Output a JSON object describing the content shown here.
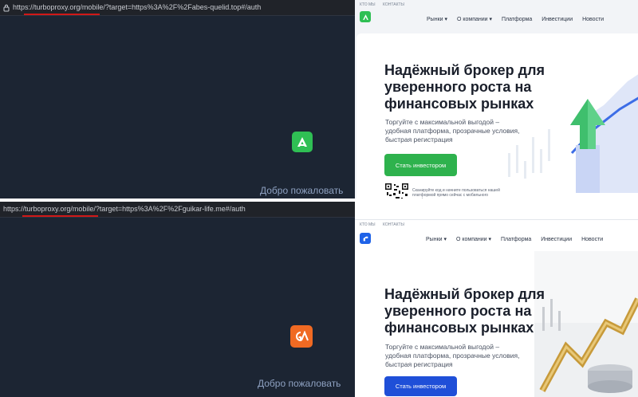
{
  "top": {
    "url": "https://turboproxy.org/mobile/?target=https%3A%2F%2Fabes-quelid.top#/auth",
    "welcome": "Добро пожаловать",
    "logo_icon": "green-a-logo-icon",
    "logo_color": "#2fbf54",
    "site": {
      "topline": [
        "КТО МЫ",
        "КОНТАКТЫ"
      ],
      "nav": [
        "Рынки ▾",
        "О компании ▾",
        "Платформа",
        "Инвестиции",
        "Новости"
      ],
      "hero_title": "Надёжный брокер для уверенного роста на финансовых рынках",
      "hero_subtitle": "Торгуйте с максимальной выгодой – удобная платформа, прозрачные условия, быстрая регистрация",
      "cta_label": "Стать инвестором",
      "cta_color": "#2eb24d",
      "qr_text": "Сканируйте код и начните пользоваться нашей платформой прямо сейчас с мобильного телефона",
      "logo_color": "#2fbf54"
    }
  },
  "bottom": {
    "url": "https://turboproxy.org/mobile/?target=https%3A%2F%2Fguikar-life.me#/auth",
    "welcome": "Добро пожаловать",
    "logo_icon": "orange-ga-logo-icon",
    "logo_color": "#f06a23",
    "site": {
      "topline": [
        "КТО МЫ",
        "КОНТАКТЫ"
      ],
      "nav": [
        "Рынки ▾",
        "О компании ▾",
        "Платформа",
        "Инвестиции",
        "Новости"
      ],
      "hero_title": "Надёжный брокер для уверенного роста на финансовых рынках",
      "hero_subtitle": "Торгуйте с максимальной выгодой – удобная платформа, прозрачные условия, быстрая регистрация",
      "cta_label": "Стать инвестором",
      "cta_color": "#1f4fd8",
      "logo_color": "#1f63e8"
    }
  }
}
